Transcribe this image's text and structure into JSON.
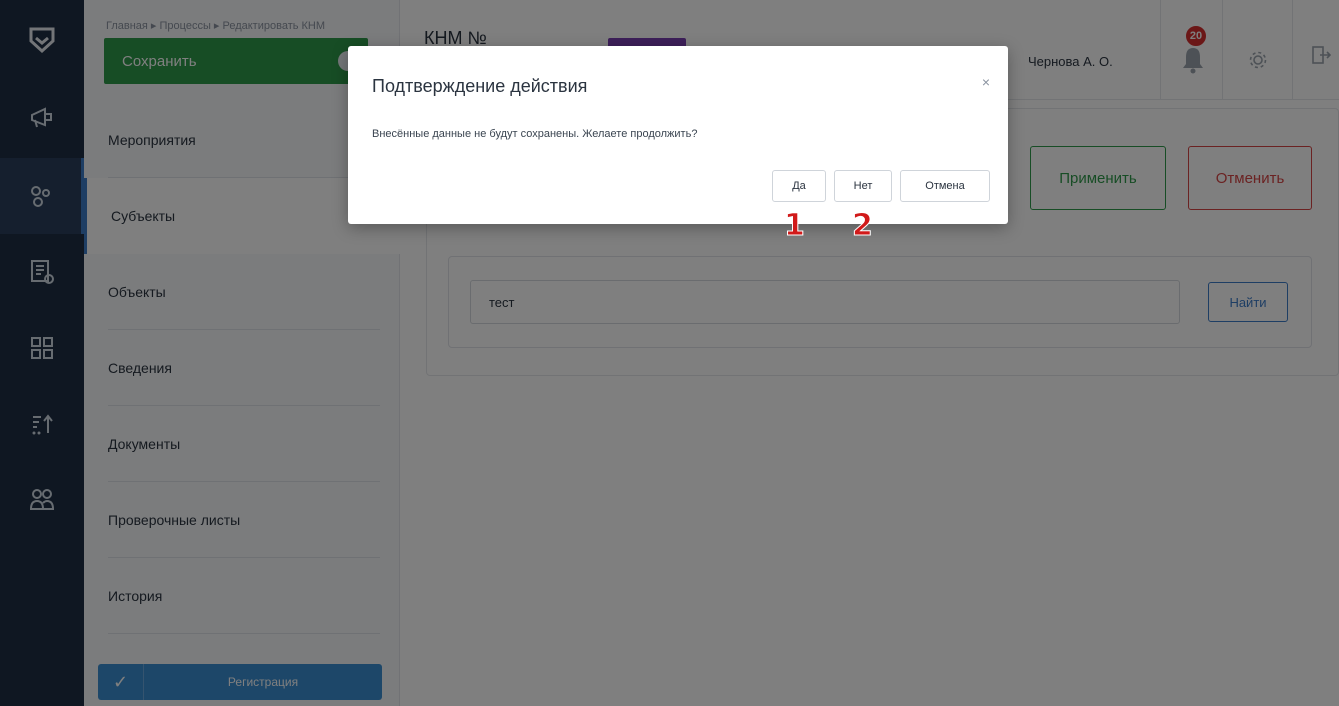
{
  "breadcrumb": "Главная ▸ Процессы ▸ Редактировать КНМ",
  "header": {
    "save_label": "Сохранить",
    "title_partial": "КНМ №",
    "user_name": "Чернова А. О.",
    "notifications_count": "20"
  },
  "sidebar": {
    "items": [
      {
        "label": "Мероприятия"
      },
      {
        "label": "Субъекты"
      },
      {
        "label": "Объекты"
      },
      {
        "label": "Сведения"
      },
      {
        "label": "Документы"
      },
      {
        "label": "Проверочные листы"
      },
      {
        "label": "История"
      }
    ],
    "registration_label": "Регистрация"
  },
  "rail_icons": [
    "logo-shield-icon",
    "megaphone-icon",
    "gears-icon",
    "document-list-icon",
    "grid-icon",
    "sort-icon",
    "users-icon"
  ],
  "main": {
    "apply_label": "Применить",
    "cancel_label": "Отменить",
    "search_value": "тест",
    "find_label": "Найти"
  },
  "modal": {
    "title": "Подтверждение действия",
    "close_symbol": "×",
    "message": "Внесённые данные не будут сохранены. Желаете продолжить?",
    "yes_label": "Да",
    "no_label": "Нет",
    "cancel_label": "Отмена"
  },
  "annotations": {
    "marker_1": "1",
    "marker_2": "2"
  },
  "colors": {
    "rail_bg": "#1e2f45",
    "accent_green": "#2e9a4a",
    "accent_red": "#d64545",
    "accent_blue": "#3d7cc9",
    "badge_red": "#d62f2f",
    "tag_purple": "#7a3fb3",
    "marker_red": "#d11a1a"
  }
}
